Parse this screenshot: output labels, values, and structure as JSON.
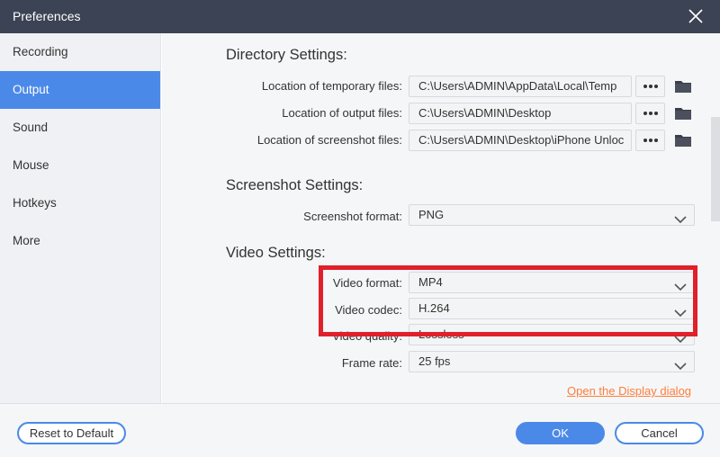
{
  "window": {
    "title": "Preferences",
    "close_icon": "close-icon"
  },
  "sidebar": {
    "items": [
      {
        "label": "Recording"
      },
      {
        "label": "Output",
        "active": true
      },
      {
        "label": "Sound"
      },
      {
        "label": "Mouse"
      },
      {
        "label": "Hotkeys"
      },
      {
        "label": "More"
      }
    ]
  },
  "directory": {
    "title": "Directory Settings:",
    "temp": {
      "label": "Location of temporary files:",
      "value": "C:\\Users\\ADMIN\\AppData\\Local\\Temp"
    },
    "output": {
      "label": "Location of output files:",
      "value": "C:\\Users\\ADMIN\\Desktop"
    },
    "screenshot": {
      "label": "Location of screenshot files:",
      "value": "C:\\Users\\ADMIN\\Desktop\\iPhone Unloc"
    }
  },
  "screenshot_settings": {
    "title": "Screenshot Settings:",
    "format_label": "Screenshot format:",
    "format_value": "PNG"
  },
  "video_settings": {
    "title": "Video Settings:",
    "format_label": "Video format:",
    "format_value": "MP4",
    "codec_label": "Video codec:",
    "codec_value": "H.264",
    "quality_label": "Video quality:",
    "quality_value": "Lossless",
    "framerate_label": "Frame rate:",
    "framerate_value": "25 fps"
  },
  "link": {
    "label": "Open the Display dialog"
  },
  "footer": {
    "reset_label": "Reset to Default",
    "ok_label": "OK",
    "cancel_label": "Cancel"
  },
  "colors": {
    "titlebar": "#3b4354",
    "accent": "#4b89e8",
    "link": "#ff7e3a",
    "highlight": "#e0202a"
  }
}
